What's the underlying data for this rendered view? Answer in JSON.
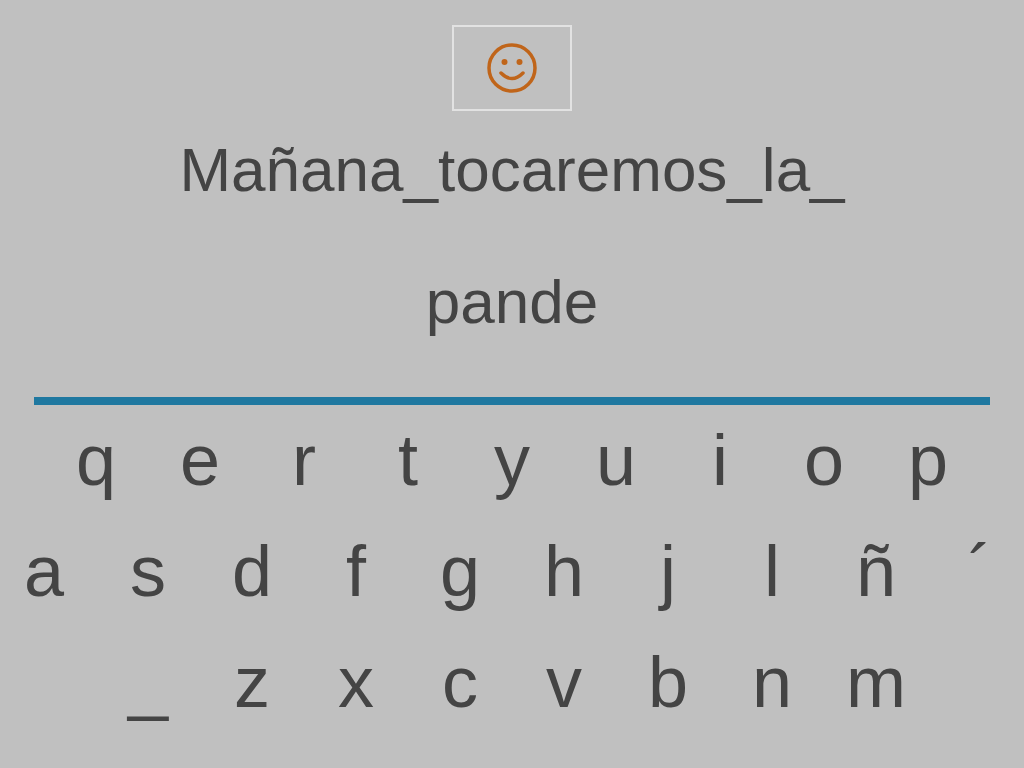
{
  "sentence_lines": [
    "Mañana_tocaremos_la_",
    "pande"
  ],
  "keyboard_rows": [
    [
      "q",
      "e",
      "r",
      "t",
      "y",
      "u",
      "i",
      "o",
      "p"
    ],
    [
      "a",
      "s",
      "d",
      "f",
      "g",
      "h",
      "j",
      "l",
      "ñ",
      "´"
    ],
    [
      "_",
      "z",
      "x",
      "c",
      "v",
      "b",
      "n",
      "m"
    ]
  ]
}
